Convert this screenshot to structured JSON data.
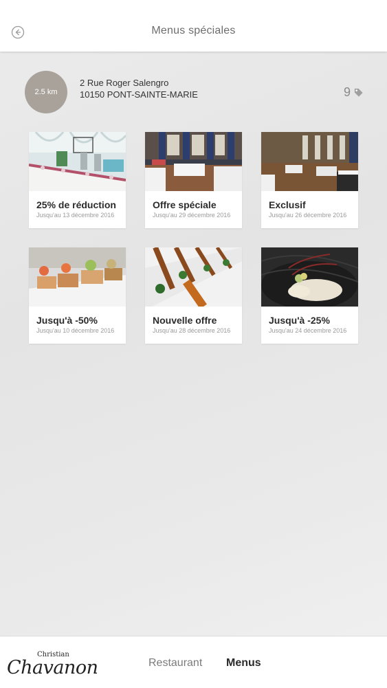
{
  "header": {
    "title": "Menus spéciales",
    "back_icon": "arrow-left-circle-icon"
  },
  "location": {
    "distance": "2.5 km",
    "street": "2 Rue Roger Salengro",
    "city": "10150 PONT-SAINTE-MARIE",
    "offers_count": "9",
    "offers_icon": "tag-icon",
    "circle_color": "#a9a29b"
  },
  "offers": [
    {
      "title": "25% de réduction",
      "date": "Jusqu'au 13 décembre 2016",
      "image": "banquet-table-photo"
    },
    {
      "title": "Offre spéciale",
      "date": "Jusqu'au 29 décembre 2016",
      "image": "reception-hall-photo"
    },
    {
      "title": "Exclusif",
      "date": "Jusqu'au 26 décembre 2016",
      "image": "ballroom-photo"
    },
    {
      "title": "Jusqu'à -50%",
      "date": "Jusqu'au 10 décembre 2016",
      "image": "shrimp-appetizer-photo"
    },
    {
      "title": "Nouvelle offre",
      "date": "Jusqu'au 28 décembre 2016",
      "image": "canape-plate-photo"
    },
    {
      "title": "Jusqu'à -25%",
      "date": "Jusqu'au 24 décembre 2016",
      "image": "fish-dish-photo"
    }
  ],
  "footer": {
    "logo_small": "Christian",
    "logo_script": "Chavanon",
    "nav": {
      "restaurant": "Restaurant",
      "menus": "Menus"
    }
  }
}
